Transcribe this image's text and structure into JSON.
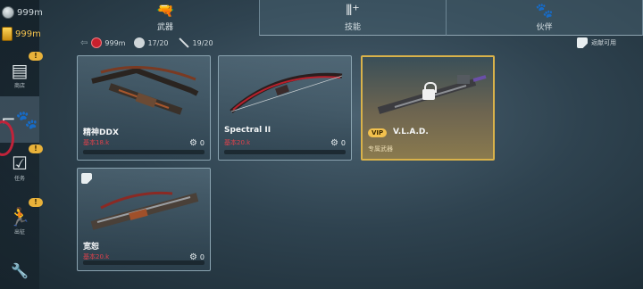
{
  "resources": {
    "silver": "999m",
    "gold": "999m"
  },
  "sidebar": {
    "items": [
      {
        "name": "shop",
        "icon": "shop-icon",
        "label": "商店",
        "alert": "!"
      },
      {
        "name": "gear",
        "icon": "gun-paw-icon",
        "label": "",
        "alert": ""
      },
      {
        "name": "tasks",
        "icon": "checkbox-icon",
        "label": "任务",
        "alert": "!"
      },
      {
        "name": "activity",
        "icon": "runner-icon",
        "label": "出征",
        "alert": "!"
      },
      {
        "name": "settings",
        "icon": "wrench-icon",
        "label": "",
        "alert": ""
      }
    ]
  },
  "tabs": [
    {
      "label": "武器",
      "icon": "revolver-icon",
      "active": true
    },
    {
      "label": "技能",
      "icon": "ammo-plus-icon",
      "active": false
    },
    {
      "label": "伙伴",
      "icon": "paw-icon",
      "active": false
    }
  ],
  "filters": {
    "cash": "999m",
    "grenade": "17/20",
    "knife": "19/20"
  },
  "unlock_hint": "返献可用",
  "cards": [
    {
      "name": "精神DDX",
      "price": "基本18.k",
      "count": "0",
      "locked": false,
      "flag": false
    },
    {
      "name": "Spectral II",
      "price": "基本20.k",
      "count": "0",
      "locked": false,
      "flag": false
    },
    {
      "name": "V.L.A.D.",
      "badge": "VIP",
      "subtitle": "专属武器",
      "locked": true
    },
    {
      "name": "宽恕",
      "price": "基本20.k",
      "count": "0",
      "locked": false,
      "flag": true
    }
  ],
  "colors": {
    "accent_gold": "#d9b24a",
    "price_red": "#e0414b"
  }
}
